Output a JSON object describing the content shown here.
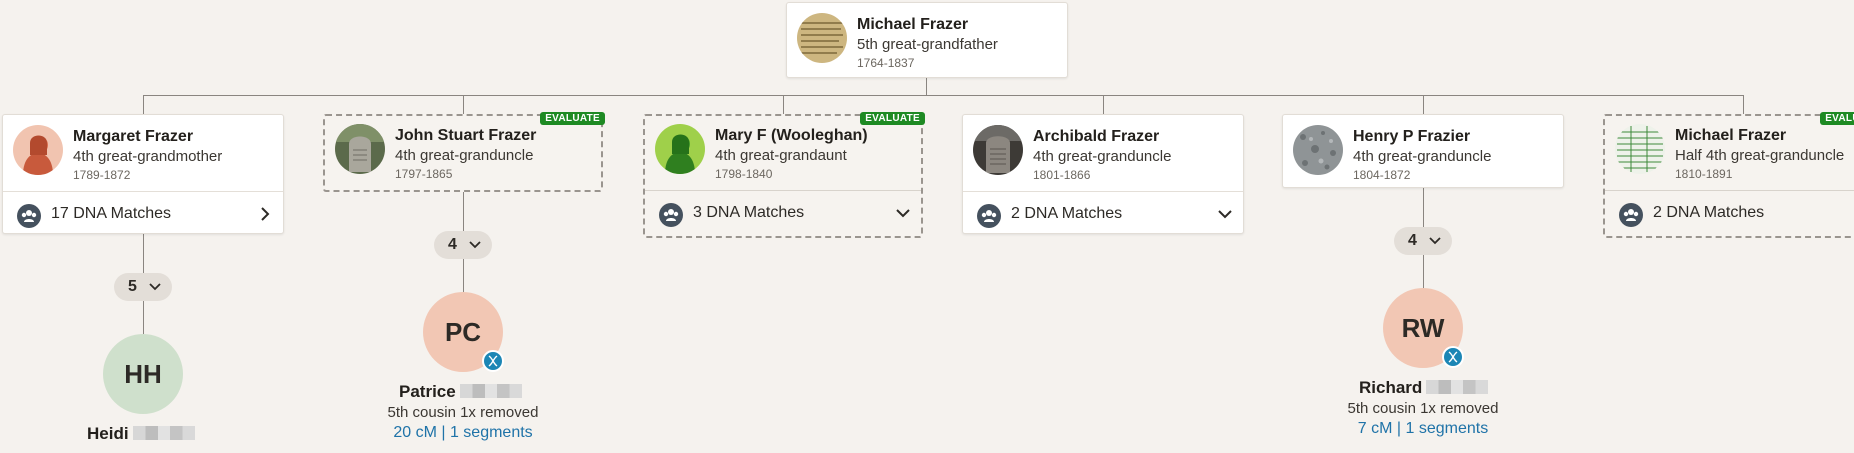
{
  "colors": {
    "background": "#f5f2ee",
    "evaluate_badge": "#1e8a23",
    "link": "#1f73a8",
    "dna_dot": "#1c86b5",
    "avatar_hh": "#cfe0cc",
    "avatar_pc": "#f2c7b4",
    "avatar_rw": "#f2c7b4"
  },
  "root": {
    "name": "Michael Frazer",
    "relation": "5th great-grandfather",
    "dates": "1764-1837",
    "photo_icon": "document-photo-icon"
  },
  "children": [
    {
      "name": "Margaret Frazer",
      "relation": "4th great-grandmother",
      "dates": "1789-1872",
      "photo_icon": "female-silhouette-icon",
      "evaluate": "",
      "dna_matches": "17 DNA Matches",
      "arrow": "chevron-right-icon"
    },
    {
      "name": "John Stuart Frazer",
      "relation": "4th great-granduncle",
      "dates": "1797-1865",
      "photo_icon": "gravestone-photo-icon",
      "evaluate": "EVALUATE",
      "dna_matches": "",
      "arrow": ""
    },
    {
      "name": "Mary F (Wooleghan)",
      "relation": "4th great-grandaunt",
      "dates": "1798-1840",
      "photo_icon": "female-silhouette-icon",
      "evaluate": "EVALUATE",
      "dna_matches": "3 DNA Matches",
      "arrow": "chevron-down-icon"
    },
    {
      "name": "Archibald Frazer",
      "relation": "4th great-granduncle",
      "dates": "1801-1866",
      "photo_icon": "gravestone-photo-icon",
      "evaluate": "",
      "dna_matches": "2 DNA Matches",
      "arrow": "chevron-down-icon"
    },
    {
      "name": "Henry P Frazier",
      "relation": "4th great-granduncle",
      "dates": "1804-1872",
      "photo_icon": "stone-photo-icon",
      "evaluate": "",
      "dna_matches": "",
      "arrow": ""
    },
    {
      "name": "Michael Frazer",
      "relation": "Half 4th great-granduncle",
      "dates": "1810-1891",
      "photo_icon": "document-photo-icon",
      "evaluate": "EVALUATE",
      "dna_matches": "2 DNA Matches",
      "arrow": ""
    }
  ],
  "expanders": {
    "margaret": "5",
    "john": "4",
    "henry": "4"
  },
  "matches": {
    "heidi": {
      "initials": "HH",
      "name": "Heidi"
    },
    "patrice": {
      "initials": "PC",
      "name": "Patrice",
      "relation": "5th cousin 1x removed",
      "cm": "20 cM | 1 segments"
    },
    "richard": {
      "initials": "RW",
      "name": "Richard",
      "relation": "5th cousin 1x removed",
      "cm": "7 cM | 1 segments"
    }
  }
}
